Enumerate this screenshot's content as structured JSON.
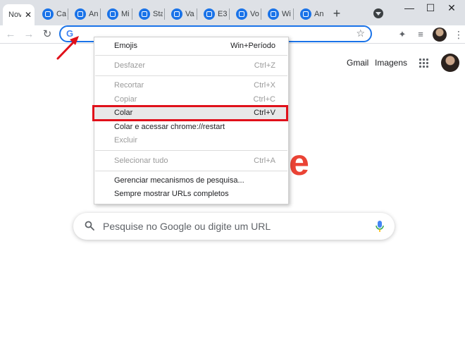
{
  "tabs": {
    "active": {
      "label": "Nov",
      "close": "✕"
    },
    "inactive": [
      {
        "label": "Ca"
      },
      {
        "label": "An"
      },
      {
        "label": "Mi"
      },
      {
        "label": "Sta"
      },
      {
        "label": "Va"
      },
      {
        "label": "E3"
      },
      {
        "label": "Vo"
      },
      {
        "label": "Wi"
      },
      {
        "label": "An"
      }
    ],
    "new_tab": "+"
  },
  "window_controls": {
    "minimize": "—",
    "maximize": "☐",
    "close": "✕"
  },
  "toolbar": {
    "back": "←",
    "forward": "→",
    "reload": "↻",
    "omnibox_icon": "G",
    "star": "☆",
    "extensions": "✦",
    "media": "≡",
    "menu": "⋮"
  },
  "page": {
    "gmail": "Gmail",
    "images": "Imagens",
    "logo_fragment": "e",
    "search_placeholder": "Pesquise no Google ou digite um URL"
  },
  "context_menu": [
    {
      "label": "Emojis",
      "shortcut": "Win+Período",
      "enabled": true
    },
    {
      "separator": true
    },
    {
      "label": "Desfazer",
      "shortcut": "Ctrl+Z",
      "enabled": false
    },
    {
      "separator": true
    },
    {
      "label": "Recortar",
      "shortcut": "Ctrl+X",
      "enabled": false
    },
    {
      "label": "Copiar",
      "shortcut": "Ctrl+C",
      "enabled": false
    },
    {
      "label": "Colar",
      "shortcut": "Ctrl+V",
      "enabled": true,
      "highlighted": true
    },
    {
      "label": "Colar e acessar chrome://restart",
      "shortcut": "",
      "enabled": true
    },
    {
      "label": "Excluir",
      "shortcut": "",
      "enabled": false
    },
    {
      "separator": true
    },
    {
      "label": "Selecionar tudo",
      "shortcut": "Ctrl+A",
      "enabled": false
    },
    {
      "separator": true
    },
    {
      "label": "Gerenciar mecanismos de pesquisa...",
      "shortcut": "",
      "enabled": true
    },
    {
      "label": "Sempre mostrar URLs completos",
      "shortcut": "",
      "enabled": true
    }
  ],
  "colors": {
    "accent": "#1a73e8",
    "annotation_red": "#e0101a",
    "logo_red": "#ea4335"
  }
}
